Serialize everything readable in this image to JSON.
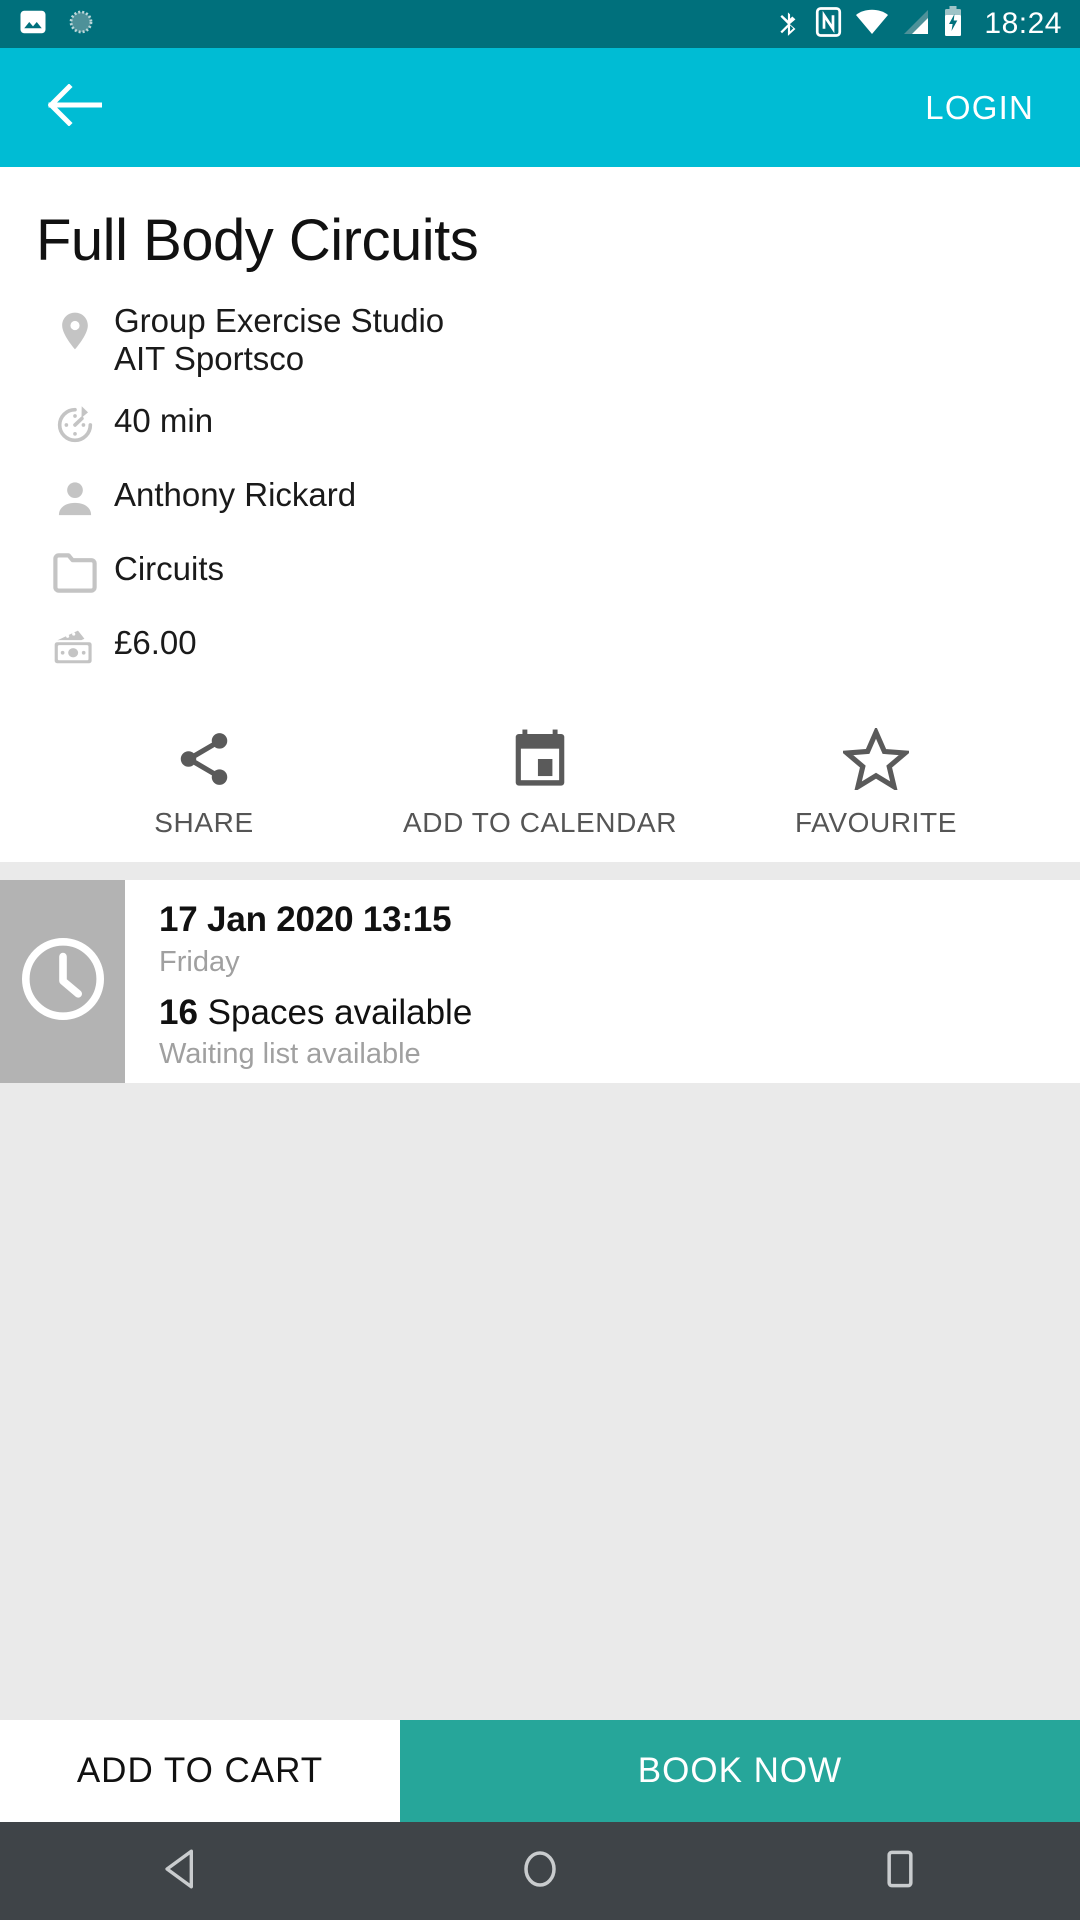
{
  "status_bar": {
    "background": "#00707C",
    "left_icons": [
      "photo-icon",
      "sync-icon"
    ],
    "right_icons": [
      "bluetooth-icon",
      "nfc-icon",
      "wifi-icon",
      "cellular-signal-icon",
      "battery-charging-icon"
    ],
    "time": "18:24"
  },
  "app_bar": {
    "background": "#00BCD4",
    "back_icon": "back-arrow-icon",
    "login_label": "LOGIN"
  },
  "detail": {
    "title": "Full Body Circuits",
    "rows": [
      {
        "icon": "location-pin-icon",
        "text": "Group Exercise Studio\nAIT Sportsco",
        "line1": "Group Exercise Studio",
        "line2": "AIT Sportsco"
      },
      {
        "icon": "timer-icon",
        "text": "40 min"
      },
      {
        "icon": "person-icon",
        "text": "Anthony Rickard"
      },
      {
        "icon": "folder-icon",
        "text": "Circuits"
      },
      {
        "icon": "money-icon",
        "text": "£6.00"
      }
    ]
  },
  "actions": [
    {
      "icon": "share-icon",
      "label": "SHARE"
    },
    {
      "icon": "calendar-icon",
      "label": "ADD TO CALENDAR"
    },
    {
      "icon": "star-outline-icon",
      "label": "FAVOURITE"
    }
  ],
  "session": {
    "thumb_icon": "clock-icon",
    "thumb_background": "#B3B3B3",
    "datetime": "17 Jan 2020 13:15",
    "day": "Friday",
    "spaces_count": "16",
    "spaces_label": "Spaces available",
    "waiting_list": "Waiting list available"
  },
  "bottom_bar": {
    "add_to_cart_label": "ADD TO CART",
    "book_now_label": "BOOK NOW",
    "book_now_color": "#26A69A"
  },
  "nav_bar": {
    "background": "#3F4448",
    "buttons": [
      "back-triangle-icon",
      "home-circle-icon",
      "recents-square-icon"
    ]
  }
}
